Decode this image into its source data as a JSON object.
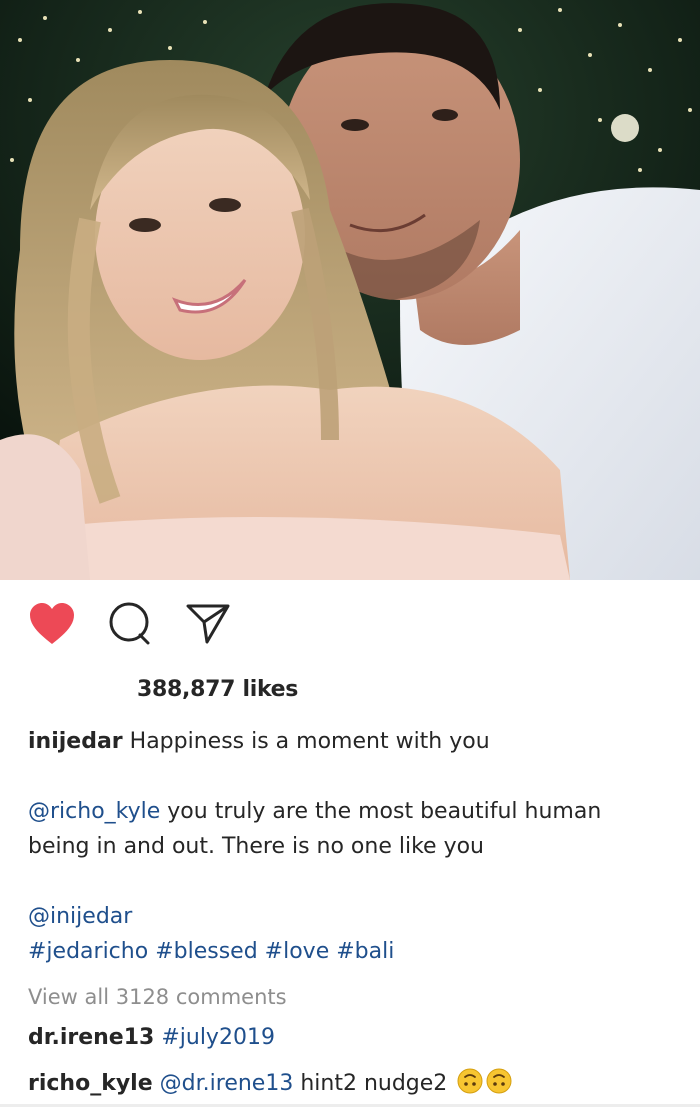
{
  "post": {
    "likes": "388,877 likes",
    "caption": {
      "username": "inijedar",
      "text": "Happiness is a moment with you",
      "mention1": "@richo_kyle",
      "line2_text": "you truly are the most beautiful human",
      "line3_text": "being in and out. There is no one like you",
      "mention2": "@inijedar",
      "hashtags": [
        "#jedaricho",
        "#blessed",
        "#love",
        "#bali"
      ]
    },
    "view_all_comments": "View all 3128 comments",
    "comments": [
      {
        "username": "dr.irene13",
        "text": "#july2019"
      },
      {
        "username": "richo_kyle",
        "mention": "@dr.irene13",
        "text": "hint2 nudge2"
      }
    ]
  },
  "colors": {
    "heart": "#ed4956",
    "link": "#1f4f8c",
    "muted": "#8e8e8e",
    "text": "#262626"
  },
  "icons": [
    "heart-filled-icon",
    "comment-icon",
    "share-icon",
    "upside-down-face-emoji"
  ]
}
